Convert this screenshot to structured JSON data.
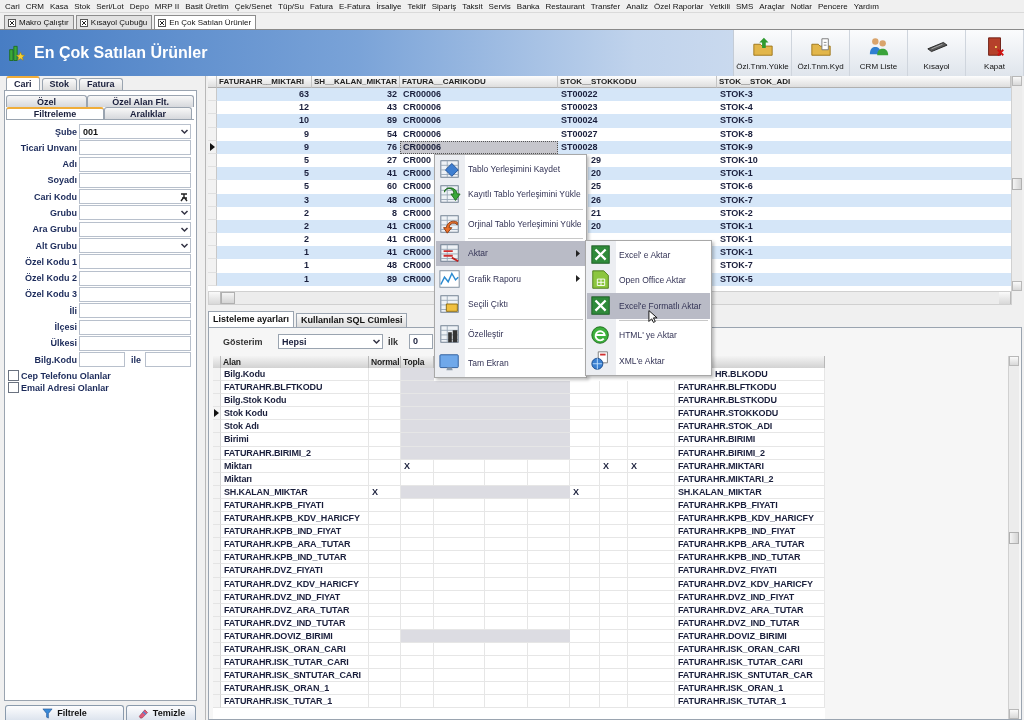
{
  "menu_bar": [
    "Cari",
    "CRM",
    "Kasa",
    "Stok",
    "Seri/Lot",
    "Depo",
    "MRP II",
    "Basit Üretim",
    "Çek/Senet",
    "Tüp/Su",
    "Fatura",
    "E-Fatura",
    "İrsaliye",
    "Teklif",
    "Sipariş",
    "Taksit",
    "Servis",
    "Banka",
    "Restaurant",
    "Transfer",
    "Analiz",
    "Özel Raporlar",
    "Yetkili",
    "SMS",
    "Araçlar",
    "Notlar",
    "Pencere",
    "Yardım"
  ],
  "document_tabs": [
    {
      "label": "Makro Çalıştır",
      "selected": false
    },
    {
      "label": "Kısayol Çubuğu",
      "selected": false
    },
    {
      "label": "En Çok Satılan Ürünler",
      "selected": true
    }
  ],
  "header": {
    "title": "En Çok Satılan Ürünler",
    "toolbar": [
      "Özl.Tnm.Yükle",
      "Özl.Tnm.Kyd",
      "CRM Liste",
      "Kısayol",
      "Kapat"
    ]
  },
  "filter_panel": {
    "tabs": [
      {
        "label": "Cari",
        "selected": true
      },
      {
        "label": "Stok",
        "selected": false
      },
      {
        "label": "Fatura",
        "selected": false
      }
    ],
    "subtab_rows": [
      {
        "tabs": [
          {
            "label": "Özel",
            "selected": false
          },
          {
            "label": "Özel Alan Flt.",
            "selected": false
          }
        ]
      },
      {
        "tabs": [
          {
            "label": "Filtreleme",
            "selected": true
          },
          {
            "label": "Aralıklar",
            "selected": false
          }
        ]
      }
    ],
    "fields": [
      {
        "label": "Şube",
        "kind": "combo",
        "value": "001"
      },
      {
        "label": "Ticari Unvanı",
        "kind": "text"
      },
      {
        "label": "Adı",
        "kind": "text"
      },
      {
        "label": "Soyadı",
        "kind": "text"
      },
      {
        "label": "Cari Kodu",
        "kind": "lookup"
      },
      {
        "label": "Grubu",
        "kind": "combo"
      },
      {
        "label": "Ara Grubu",
        "kind": "combo"
      },
      {
        "label": "Alt Grubu",
        "kind": "combo"
      },
      {
        "label": "Özel Kodu 1",
        "kind": "text"
      },
      {
        "label": "Özel Kodu 2",
        "kind": "text"
      },
      {
        "label": "Özel Kodu 3",
        "kind": "text"
      },
      {
        "label": "İli",
        "kind": "text"
      },
      {
        "label": "İlçesi",
        "kind": "text"
      },
      {
        "label": "Ülkesi",
        "kind": "text"
      },
      {
        "label": "Bilg.Kodu",
        "kind": "range",
        "separator": "ile"
      }
    ],
    "checkboxes": [
      {
        "label": "Cep Telefonu Olanlar",
        "checked": false
      },
      {
        "label": "Email Adresi Olanlar",
        "checked": false
      }
    ],
    "buttons": [
      "Filtrele",
      "Temizle"
    ]
  },
  "results_grid": {
    "columns": [
      {
        "label": "FATURAHR__MIKTARI",
        "kind": "number"
      },
      {
        "label": "SH__KALAN_MIKTAR",
        "kind": "number"
      },
      {
        "label": "FATURA__CARIKODU",
        "kind": "text"
      },
      {
        "label": "STOK__STOKKODU",
        "kind": "text"
      },
      {
        "label": "STOK__STOK_ADI",
        "kind": "text"
      }
    ],
    "rows": [
      {
        "miktari": "63",
        "kalan": "32",
        "carikodu": "CR00006",
        "stokkodu": "ST00022",
        "stok_adi": "STOK-3",
        "selected": false,
        "under_menu": false
      },
      {
        "miktari": "12",
        "kalan": "43",
        "carikodu": "CR00006",
        "stokkodu": "ST00023",
        "stok_adi": "STOK-4",
        "selected": false,
        "under_menu": false
      },
      {
        "miktari": "10",
        "kalan": "89",
        "carikodu": "CR00006",
        "stokkodu": "ST00024",
        "stok_adi": "STOK-5",
        "selected": false,
        "under_menu": false
      },
      {
        "miktari": "9",
        "kalan": "54",
        "carikodu": "CR00006",
        "stokkodu": "ST00027",
        "stok_adi": "STOK-8",
        "selected": false,
        "under_menu": false
      },
      {
        "miktari": "9",
        "kalan": "76",
        "carikodu": "CR00006",
        "stokkodu": "ST00028",
        "stok_adi": "STOK-9",
        "selected": true,
        "under_menu": false
      },
      {
        "miktari": "5",
        "kalan": "27",
        "carikodu": "CR000",
        "stokkodu": "29",
        "stok_adi": "STOK-10",
        "selected": false,
        "under_menu": true
      },
      {
        "miktari": "5",
        "kalan": "41",
        "carikodu": "CR000",
        "stokkodu": "20",
        "stok_adi": "STOK-1",
        "selected": false,
        "under_menu": true
      },
      {
        "miktari": "5",
        "kalan": "60",
        "carikodu": "CR000",
        "stokkodu": "25",
        "stok_adi": "STOK-6",
        "selected": false,
        "under_menu": true
      },
      {
        "miktari": "3",
        "kalan": "48",
        "carikodu": "CR000",
        "stokkodu": "26",
        "stok_adi": "STOK-7",
        "selected": false,
        "under_menu": true
      },
      {
        "miktari": "2",
        "kalan": "8",
        "carikodu": "CR000",
        "stokkodu": "21",
        "stok_adi": "STOK-2",
        "selected": false,
        "under_menu": true
      },
      {
        "miktari": "2",
        "kalan": "41",
        "carikodu": "CR000",
        "stokkodu": "20",
        "stok_adi": "STOK-1",
        "selected": false,
        "under_menu": true
      },
      {
        "miktari": "2",
        "kalan": "41",
        "carikodu": "CR000",
        "stok_adi": "STOK-1",
        "selected": false,
        "under_menu": true
      },
      {
        "miktari": "1",
        "kalan": "41",
        "carikodu": "CR000",
        "stok_adi": "STOK-1",
        "selected": false,
        "under_menu": true
      },
      {
        "miktari": "1",
        "kalan": "48",
        "carikodu": "CR000",
        "stok_adi": "STOK-7",
        "selected": false,
        "under_menu": true
      },
      {
        "miktari": "1",
        "kalan": "89",
        "carikodu": "CR000",
        "stok_adi": "STOK-5",
        "selected": false,
        "under_menu": true
      }
    ]
  },
  "settings_panel": {
    "tabs": [
      {
        "label": "Listeleme ayarları",
        "selected": true
      },
      {
        "label": "Kullanılan SQL Cümlesi",
        "selected": false
      }
    ],
    "display_label": "Gösterim",
    "display_value": "Hepsi",
    "first_label": "İlk",
    "first_value": "0",
    "grid": {
      "columns": [
        {
          "label": "Alan"
        },
        {
          "label": "Normal"
        },
        {
          "label": "Topla"
        }
      ],
      "rows": [
        {
          "alan": "Bilg.Kodu",
          "field": "HR.BLKODU",
          "disabled": true,
          "selected": false,
          "under_menu": true
        },
        {
          "alan": "FATURAHR.BLFTKODU",
          "field": "FATURAHR.BLFTKODU",
          "disabled": true,
          "selected": false,
          "under_menu": false
        },
        {
          "alan": "Bilg.Stok Kodu",
          "field": "FATURAHR.BLSTKODU",
          "disabled": true,
          "selected": false,
          "under_menu": false
        },
        {
          "alan": "Stok Kodu",
          "field": "FATURAHR.STOKKODU",
          "disabled": true,
          "selected": true,
          "under_menu": false
        },
        {
          "alan": "Stok Adı",
          "field": "FATURAHR.STOK_ADI",
          "disabled": true,
          "selected": false,
          "under_menu": false
        },
        {
          "alan": "Birimi",
          "field": "FATURAHR.BIRIMI",
          "disabled": true,
          "selected": false,
          "under_menu": false
        },
        {
          "alan": "FATURAHR.BIRIMI_2",
          "field": "FATURAHR.BIRIMI_2",
          "disabled": true,
          "selected": false,
          "under_menu": false
        },
        {
          "alan": "Miktarı",
          "field": "FATURAHR.MIKTARI",
          "cells": {
            "toplam": "X",
            "column_8": "X",
            "column_9": "X"
          },
          "disabled": false,
          "selected": false,
          "under_menu": false
        },
        {
          "alan": "Miktarı",
          "field": "FATURAHR.MIKTARI_2",
          "disabled": false,
          "selected": false,
          "under_menu": false
        },
        {
          "alan": "SH.KALAN_MIKTAR",
          "field": "SH.KALAN_MIKTAR",
          "cells": {
            "normal": "X",
            "column_7": "X"
          },
          "disabled": true,
          "selected": false,
          "under_menu": false
        },
        {
          "alan": "FATURAHR.KPB_FIYATI",
          "field": "FATURAHR.KPB_FIYATI",
          "disabled": false,
          "selected": false,
          "under_menu": false
        },
        {
          "alan": "FATURAHR.KPB_KDV_HARICFY",
          "field": "FATURAHR.KPB_KDV_HARICFY",
          "disabled": false,
          "selected": false,
          "under_menu": false
        },
        {
          "alan": "FATURAHR.KPB_IND_FIYAT",
          "field": "FATURAHR.KPB_IND_FIYAT",
          "disabled": false,
          "selected": false,
          "under_menu": false
        },
        {
          "alan": "FATURAHR.KPB_ARA_TUTAR",
          "field": "FATURAHR.KPB_ARA_TUTAR",
          "disabled": false,
          "selected": false,
          "under_menu": false
        },
        {
          "alan": "FATURAHR.KPB_IND_TUTAR",
          "field": "FATURAHR.KPB_IND_TUTAR",
          "disabled": false,
          "selected": false,
          "under_menu": false
        },
        {
          "alan": "FATURAHR.DVZ_FIYATI",
          "field": "FATURAHR.DVZ_FIYATI",
          "disabled": false,
          "selected": false,
          "under_menu": false
        },
        {
          "alan": "FATURAHR.DVZ_KDV_HARICFY",
          "field": "FATURAHR.DVZ_KDV_HARICFY",
          "disabled": false,
          "selected": false,
          "under_menu": false
        },
        {
          "alan": "FATURAHR.DVZ_IND_FIYAT",
          "field": "FATURAHR.DVZ_IND_FIYAT",
          "disabled": false,
          "selected": false,
          "under_menu": false
        },
        {
          "alan": "FATURAHR.DVZ_ARA_TUTAR",
          "field": "FATURAHR.DVZ_ARA_TUTAR",
          "disabled": false,
          "selected": false,
          "under_menu": false
        },
        {
          "alan": "FATURAHR.DVZ_IND_TUTAR",
          "field": "FATURAHR.DVZ_IND_TUTAR",
          "disabled": false,
          "selected": false,
          "under_menu": false
        },
        {
          "alan": "FATURAHR.DOVIZ_BIRIMI",
          "field": "FATURAHR.DOVIZ_BIRIMI",
          "disabled": true,
          "selected": false,
          "under_menu": false
        },
        {
          "alan": "FATURAHR.ISK_ORAN_CARI",
          "field": "FATURAHR.ISK_ORAN_CARI",
          "disabled": false,
          "selected": false,
          "under_menu": false
        },
        {
          "alan": "FATURAHR.ISK_TUTAR_CARI",
          "field": "FATURAHR.ISK_TUTAR_CARI",
          "disabled": false,
          "selected": false,
          "under_menu": false
        },
        {
          "alan": "FATURAHR.ISK_SNTUTAR_CARI",
          "field": "FATURAHR.ISK_SNTUTAR_CAR",
          "disabled": false,
          "selected": false,
          "under_menu": false
        },
        {
          "alan": "FATURAHR.ISK_ORAN_1",
          "field": "FATURAHR.ISK_ORAN_1",
          "disabled": false,
          "selected": false,
          "under_menu": false
        },
        {
          "alan": "FATURAHR.ISK_TUTAR_1",
          "field": "FATURAHR.ISK_TUTAR_1",
          "disabled": false,
          "selected": false,
          "under_menu": false
        }
      ]
    }
  },
  "context_menu": {
    "items": [
      {
        "kind": "item",
        "label": "Tablo Yerleşimini Kaydet",
        "selected": false,
        "has_submenu": false
      },
      {
        "kind": "item",
        "label": "Kayıtlı Tablo Yerleşimini Yükle",
        "selected": false,
        "has_submenu": false
      },
      {
        "kind": "separator"
      },
      {
        "kind": "item",
        "label": "Orjinal Tablo Yerleşimini Yükle",
        "selected": false,
        "has_submenu": false
      },
      {
        "kind": "separator"
      },
      {
        "kind": "item",
        "label": "Aktar",
        "selected": true,
        "has_submenu": true
      },
      {
        "kind": "item",
        "label": "Grafik Raporu",
        "selected": false,
        "has_submenu": true
      },
      {
        "kind": "item",
        "label": "Seçili Çıktı",
        "selected": false,
        "has_submenu": false
      },
      {
        "kind": "separator"
      },
      {
        "kind": "item",
        "label": "Özelleştir",
        "selected": false,
        "has_submenu": false
      },
      {
        "kind": "separator"
      },
      {
        "kind": "item",
        "label": "Tam Ekran",
        "selected": false,
        "has_submenu": false
      }
    ],
    "submenu": [
      {
        "kind": "item",
        "label": "Excel' e Aktar",
        "selected": false
      },
      {
        "kind": "item",
        "label": "Open Office Aktar",
        "selected": false
      },
      {
        "kind": "item",
        "label": "Excel'e Formatlı Aktar",
        "selected": true
      },
      {
        "kind": "separator"
      },
      {
        "kind": "item",
        "label": "HTML' ye Aktar",
        "selected": false
      },
      {
        "kind": "item",
        "label": "XML'e Aktar",
        "selected": false
      }
    ]
  }
}
